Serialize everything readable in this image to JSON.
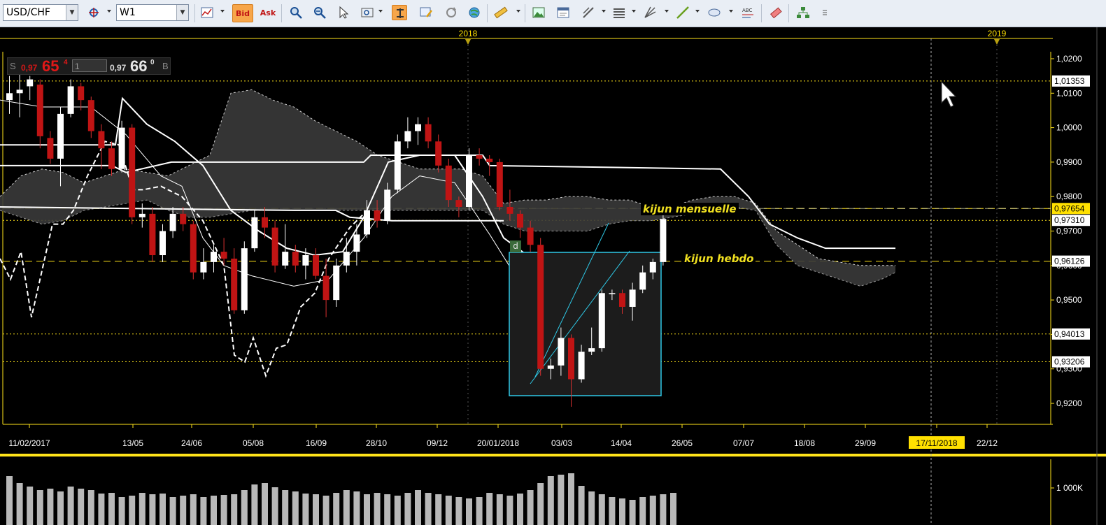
{
  "toolbar": {
    "symbol": "USD/CHF",
    "timeframe": "W1",
    "bid_label": "Bid",
    "ask_label": "Ask"
  },
  "price_panel": {
    "sell_label": "S",
    "sell_prefix": "0,97",
    "sell_big": "65",
    "sell_sup": "4",
    "lot_value": "1",
    "buy_prefix": "0,97",
    "buy_big": "66",
    "buy_sup": "0",
    "buy_label": "B"
  },
  "annotations": {
    "kijun_mensuelle": "kijun mensuelle",
    "kijun_hebdo": "kijun hebdo",
    "d_marker": "d"
  },
  "colors": {
    "background": "#000000",
    "grid": "#ffe41a",
    "bull_candle": "#ffffff",
    "bear_candle": "#c01414",
    "cloud": "#3a3a3a",
    "rectangle": "#2ec8e6",
    "highlight_label": "#ffe000"
  },
  "chart_data": {
    "type": "candlestick",
    "symbol": "USD/CHF",
    "timeframe": "W1",
    "years": [
      "2018",
      "2019"
    ],
    "date_labels": [
      "11/02/2017",
      "13/05",
      "24/06",
      "05/08",
      "16/09",
      "28/10",
      "09/12",
      "20/01/2018",
      "03/03",
      "14/04",
      "26/05",
      "07/07",
      "18/08",
      "29/09",
      "17/11/2018",
      "22/12"
    ],
    "y_ticks": [
      "1,0200",
      "1,0100",
      "1,0000",
      "0,9900",
      "0,9800",
      "0,9700",
      "0,9600",
      "0,9500",
      "0,9400",
      "0,9300",
      "0,9200"
    ],
    "ylim": [
      0.9115,
      1.0265
    ],
    "price_levels": [
      {
        "label": "1,01353",
        "value": 1.01353,
        "style": "dotted",
        "tag": "white"
      },
      {
        "label": "0,97654",
        "value": 0.97654,
        "style": "dashed",
        "tag": "yellow"
      },
      {
        "label": "0,97310",
        "value": 0.9731,
        "style": "dotted",
        "tag": "white"
      },
      {
        "label": "0,96126",
        "value": 0.96126,
        "style": "dashed",
        "tag": "white"
      },
      {
        "label": "0,94013",
        "value": 0.94013,
        "style": "dotted",
        "tag": "white"
      },
      {
        "label": "0,93206",
        "value": 0.93206,
        "style": "dotted",
        "tag": "white"
      }
    ],
    "current_price": 0.97654,
    "volume_label": "1 000K",
    "candles": [
      {
        "o": 1.008,
        "h": 1.015,
        "l": 1.004,
        "c": 1.01
      },
      {
        "o": 1.01,
        "h": 1.017,
        "l": 1.003,
        "c": 1.011
      },
      {
        "o": 1.012,
        "h": 1.015,
        "l": 1.008,
        "c": 1.014
      },
      {
        "o": 1.0125,
        "h": 1.014,
        "l": 0.994,
        "c": 0.9975
      },
      {
        "o": 0.997,
        "h": 0.999,
        "l": 0.9895,
        "c": 0.991
      },
      {
        "o": 0.991,
        "h": 1.006,
        "l": 0.983,
        "c": 1.004
      },
      {
        "o": 1.004,
        "h": 1.014,
        "l": 1.003,
        "c": 1.012
      },
      {
        "o": 1.012,
        "h": 1.013,
        "l": 1.005,
        "c": 1.008
      },
      {
        "o": 1.008,
        "h": 1.009,
        "l": 0.997,
        "c": 0.999
      },
      {
        "o": 0.999,
        "h": 1.001,
        "l": 0.988,
        "c": 0.994
      },
      {
        "o": 0.994,
        "h": 0.996,
        "l": 0.986,
        "c": 0.988
      },
      {
        "o": 0.988,
        "h": 1.002,
        "l": 0.987,
        "c": 1.0
      },
      {
        "o": 1.0,
        "h": 1.001,
        "l": 0.972,
        "c": 0.974
      },
      {
        "o": 0.974,
        "h": 0.978,
        "l": 0.971,
        "c": 0.975
      },
      {
        "o": 0.975,
        "h": 0.977,
        "l": 0.961,
        "c": 0.963
      },
      {
        "o": 0.963,
        "h": 0.972,
        "l": 0.961,
        "c": 0.97
      },
      {
        "o": 0.97,
        "h": 0.977,
        "l": 0.968,
        "c": 0.975
      },
      {
        "o": 0.975,
        "h": 0.977,
        "l": 0.97,
        "c": 0.972
      },
      {
        "o": 0.972,
        "h": 0.973,
        "l": 0.956,
        "c": 0.958
      },
      {
        "o": 0.958,
        "h": 0.965,
        "l": 0.956,
        "c": 0.961
      },
      {
        "o": 0.961,
        "h": 0.966,
        "l": 0.958,
        "c": 0.964
      },
      {
        "o": 0.964,
        "h": 0.968,
        "l": 0.96,
        "c": 0.962
      },
      {
        "o": 0.962,
        "h": 0.965,
        "l": 0.946,
        "c": 0.947
      },
      {
        "o": 0.947,
        "h": 0.967,
        "l": 0.946,
        "c": 0.965
      },
      {
        "o": 0.965,
        "h": 0.976,
        "l": 0.964,
        "c": 0.974
      },
      {
        "o": 0.974,
        "h": 0.977,
        "l": 0.968,
        "c": 0.971
      },
      {
        "o": 0.971,
        "h": 0.973,
        "l": 0.958,
        "c": 0.96
      },
      {
        "o": 0.96,
        "h": 0.972,
        "l": 0.959,
        "c": 0.964
      },
      {
        "o": 0.964,
        "h": 0.966,
        "l": 0.958,
        "c": 0.96
      },
      {
        "o": 0.96,
        "h": 0.965,
        "l": 0.956,
        "c": 0.963
      },
      {
        "o": 0.963,
        "h": 0.965,
        "l": 0.956,
        "c": 0.957
      },
      {
        "o": 0.957,
        "h": 0.962,
        "l": 0.945,
        "c": 0.95
      },
      {
        "o": 0.95,
        "h": 0.962,
        "l": 0.948,
        "c": 0.96
      },
      {
        "o": 0.96,
        "h": 0.968,
        "l": 0.958,
        "c": 0.964
      },
      {
        "o": 0.964,
        "h": 0.972,
        "l": 0.96,
        "c": 0.969
      },
      {
        "o": 0.969,
        "h": 0.979,
        "l": 0.968,
        "c": 0.976
      },
      {
        "o": 0.976,
        "h": 0.979,
        "l": 0.971,
        "c": 0.973
      },
      {
        "o": 0.973,
        "h": 0.984,
        "l": 0.972,
        "c": 0.982
      },
      {
        "o": 0.982,
        "h": 0.998,
        "l": 0.981,
        "c": 0.996
      },
      {
        "o": 0.996,
        "h": 1.003,
        "l": 0.994,
        "c": 0.999
      },
      {
        "o": 0.999,
        "h": 1.003,
        "l": 0.995,
        "c": 1.001
      },
      {
        "o": 1.001,
        "h": 1.003,
        "l": 0.994,
        "c": 0.996
      },
      {
        "o": 0.996,
        "h": 0.998,
        "l": 0.987,
        "c": 0.989
      },
      {
        "o": 0.989,
        "h": 0.991,
        "l": 0.977,
        "c": 0.979
      },
      {
        "o": 0.979,
        "h": 0.98,
        "l": 0.974,
        "c": 0.977
      },
      {
        "o": 0.977,
        "h": 0.994,
        "l": 0.976,
        "c": 0.992
      },
      {
        "o": 0.992,
        "h": 0.994,
        "l": 0.989,
        "c": 0.991
      },
      {
        "o": 0.991,
        "h": 0.992,
        "l": 0.986,
        "c": 0.99
      },
      {
        "o": 0.99,
        "h": 0.991,
        "l": 0.976,
        "c": 0.977
      },
      {
        "o": 0.977,
        "h": 0.982,
        "l": 0.973,
        "c": 0.975
      },
      {
        "o": 0.975,
        "h": 0.976,
        "l": 0.968,
        "c": 0.971
      },
      {
        "o": 0.971,
        "h": 0.973,
        "l": 0.964,
        "c": 0.966
      },
      {
        "o": 0.966,
        "h": 0.968,
        "l": 0.928,
        "c": 0.93
      },
      {
        "o": 0.93,
        "h": 0.933,
        "l": 0.927,
        "c": 0.931
      },
      {
        "o": 0.931,
        "h": 0.942,
        "l": 0.928,
        "c": 0.939
      },
      {
        "o": 0.939,
        "h": 0.94,
        "l": 0.919,
        "c": 0.927
      },
      {
        "o": 0.927,
        "h": 0.937,
        "l": 0.926,
        "c": 0.935
      },
      {
        "o": 0.935,
        "h": 0.942,
        "l": 0.934,
        "c": 0.936
      },
      {
        "o": 0.936,
        "h": 0.953,
        "l": 0.935,
        "c": 0.952
      },
      {
        "o": 0.952,
        "h": 0.953,
        "l": 0.95,
        "c": 0.952
      },
      {
        "o": 0.952,
        "h": 0.953,
        "l": 0.946,
        "c": 0.948
      },
      {
        "o": 0.948,
        "h": 0.955,
        "l": 0.944,
        "c": 0.953
      },
      {
        "o": 0.953,
        "h": 0.96,
        "l": 0.952,
        "c": 0.958
      },
      {
        "o": 0.958,
        "h": 0.962,
        "l": 0.956,
        "c": 0.961
      },
      {
        "o": 0.961,
        "h": 0.975,
        "l": 0.96,
        "c": 0.9735
      },
      {
        "o": 0.9755,
        "h": 0.978,
        "l": 0.9755,
        "c": 0.9765
      }
    ],
    "volumes": [
      70,
      60,
      55,
      50,
      52,
      48,
      55,
      52,
      50,
      45,
      46,
      40,
      42,
      46,
      44,
      45,
      40,
      42,
      44,
      40,
      42,
      43,
      44,
      50,
      58,
      60,
      54,
      50,
      48,
      45,
      44,
      42,
      46,
      50,
      48,
      44,
      46,
      44,
      42,
      46,
      50,
      46,
      44,
      42,
      40,
      38,
      40,
      46,
      44,
      42,
      45,
      50,
      60,
      70,
      72,
      74,
      56,
      48,
      44,
      40,
      38,
      36,
      40,
      42,
      44,
      46
    ]
  }
}
